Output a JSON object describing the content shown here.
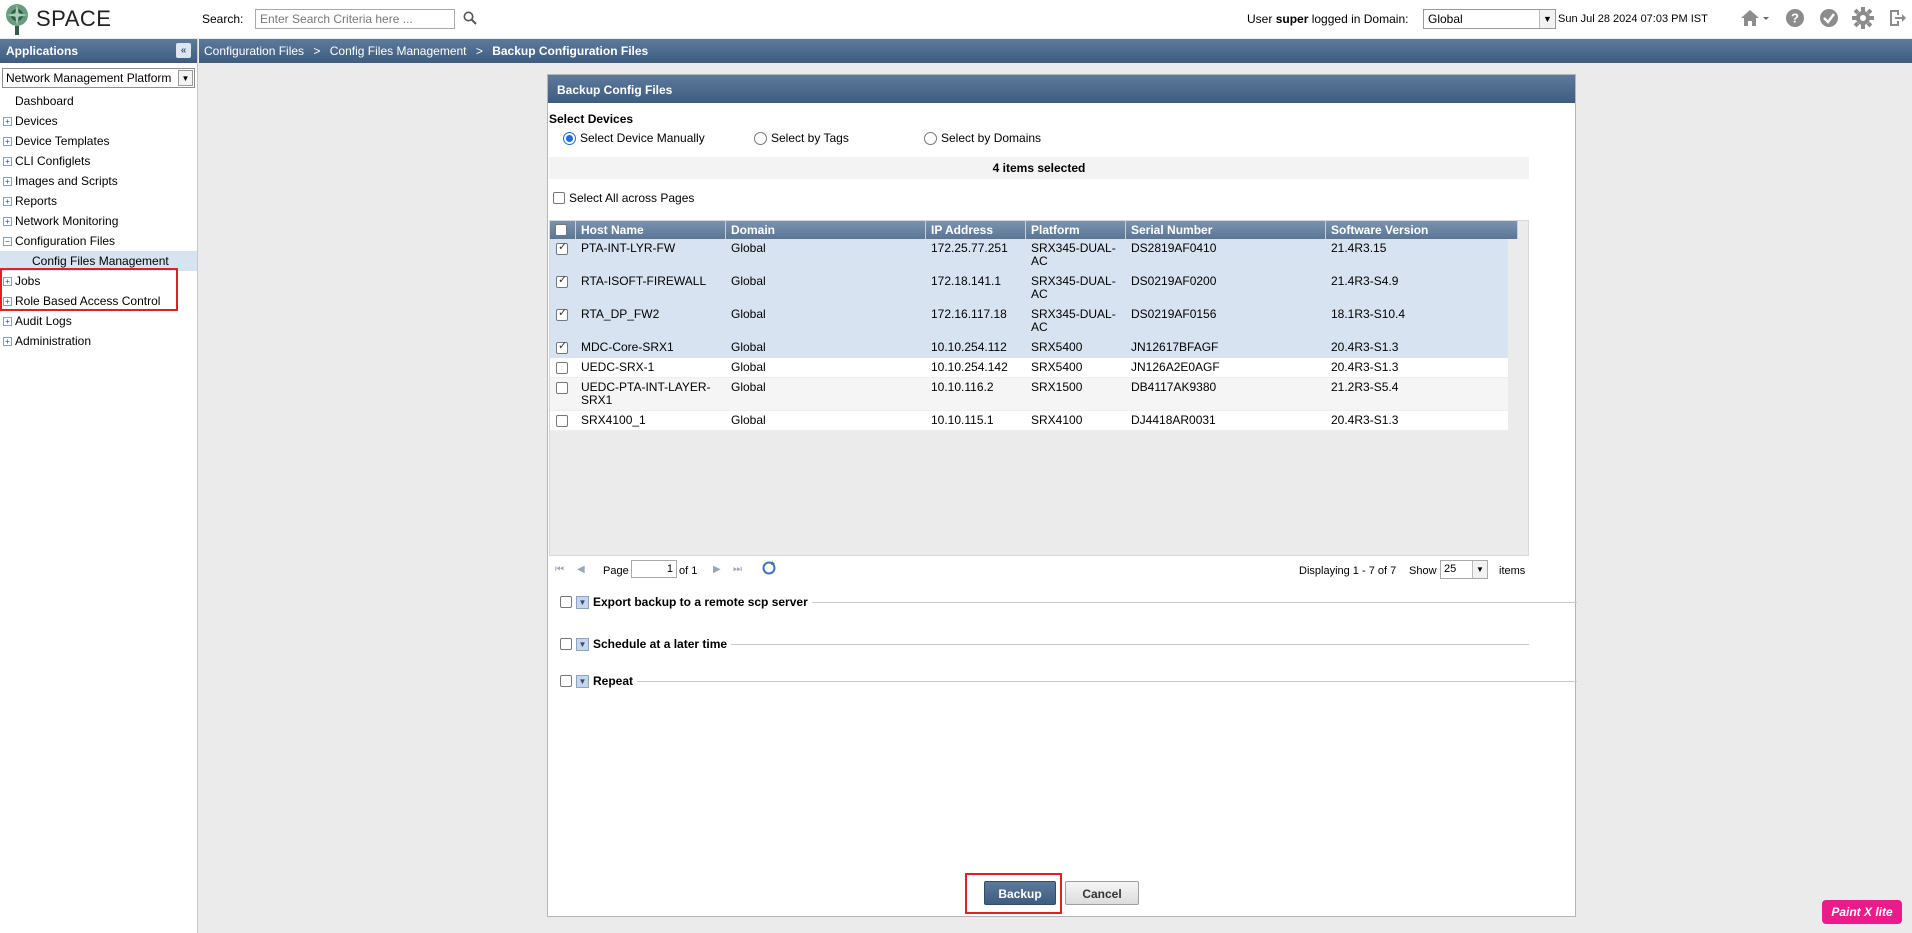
{
  "app": {
    "logo_text": "SPACE"
  },
  "search": {
    "label": "Search:",
    "placeholder": "Enter Search Criteria here ..."
  },
  "user": {
    "prefix": "User",
    "name": "super",
    "suffix": "logged in Domain:",
    "domain": "Global"
  },
  "datetime": "Sun Jul 28 2024 07:03 PM IST",
  "top_icons": [
    "home-icon",
    "help-icon",
    "tasks-check-icon",
    "gear-icon",
    "logout-icon"
  ],
  "sidebar": {
    "title": "Applications",
    "app_select": "Network Management Platform",
    "items": [
      {
        "label": "Dashboard",
        "expander": ""
      },
      {
        "label": "Devices",
        "expander": "+"
      },
      {
        "label": "Device Templates",
        "expander": "+"
      },
      {
        "label": "CLI Configlets",
        "expander": "+"
      },
      {
        "label": "Images and Scripts",
        "expander": "+"
      },
      {
        "label": "Reports",
        "expander": "+"
      },
      {
        "label": "Network Monitoring",
        "expander": "+"
      },
      {
        "label": "Configuration Files",
        "expander": "−"
      },
      {
        "label": "Config Files Management",
        "expander": ""
      },
      {
        "label": "Jobs",
        "expander": "+"
      },
      {
        "label": "Role Based Access Control",
        "expander": "+"
      },
      {
        "label": "Audit Logs",
        "expander": "+"
      },
      {
        "label": "Administration",
        "expander": "+"
      }
    ]
  },
  "breadcrumb": {
    "c1": "Configuration Files",
    "sep": ">",
    "c2": "Config Files Management",
    "c3": "Backup Configuration Files"
  },
  "dialog": {
    "title": "Backup Config Files",
    "select_devices": "Select Devices",
    "radios": [
      "Select Device Manually",
      "Select by Tags",
      "Select by Domains"
    ],
    "selected_count": "4 items selected",
    "select_all": "Select All across Pages",
    "columns": [
      "Host Name",
      "Domain",
      "IP Address",
      "Platform",
      "Serial Number",
      "Software Version"
    ],
    "rows": [
      {
        "host": "PTA-INT-LYR-FW",
        "domain": "Global",
        "ip": "172.25.77.251",
        "platform": "SRX345-DUAL-AC",
        "serial": "DS2819AF0410",
        "version": "21.4R3.15"
      },
      {
        "host": "RTA-ISOFT-FIREWALL",
        "domain": "Global",
        "ip": "172.18.141.1",
        "platform": "SRX345-DUAL-AC",
        "serial": "DS0219AF0200",
        "version": "21.4R3-S4.9"
      },
      {
        "host": "RTA_DP_FW2",
        "domain": "Global",
        "ip": "172.16.117.18",
        "platform": "SRX345-DUAL-AC",
        "serial": "DS0219AF0156",
        "version": "18.1R3-S10.4"
      },
      {
        "host": "MDC-Core-SRX1",
        "domain": "Global",
        "ip": "10.10.254.112",
        "platform": "SRX5400",
        "serial": "JN12617BFAGF",
        "version": "20.4R3-S1.3"
      },
      {
        "host": "UEDC-SRX-1",
        "domain": "Global",
        "ip": "10.10.254.142",
        "platform": "SRX5400",
        "serial": "JN126A2E0AGF",
        "version": "20.4R3-S1.3"
      },
      {
        "host": "UEDC-PTA-INT-LAYER-SRX1",
        "domain": "Global",
        "ip": "10.10.116.2",
        "platform": "SRX1500",
        "serial": "DB4117AK9380",
        "version": "21.2R3-S5.4"
      },
      {
        "host": "SRX4100_1",
        "domain": "Global",
        "ip": "10.10.115.1",
        "platform": "SRX4100",
        "serial": "DJ4418AR0031",
        "version": "20.4R3-S1.3"
      }
    ],
    "pager": {
      "page_label": "Page",
      "page_value": "1",
      "of_label": "of 1",
      "displaying": "Displaying 1 - 7 of 7",
      "show_label": "Show",
      "show_value": "25",
      "items_label": "items"
    },
    "sections": [
      "Export backup to a remote scp server",
      "Schedule at a later time",
      "Repeat"
    ],
    "backup_button": "Backup",
    "cancel_button": "Cancel"
  },
  "badge": "Paint X lite"
}
